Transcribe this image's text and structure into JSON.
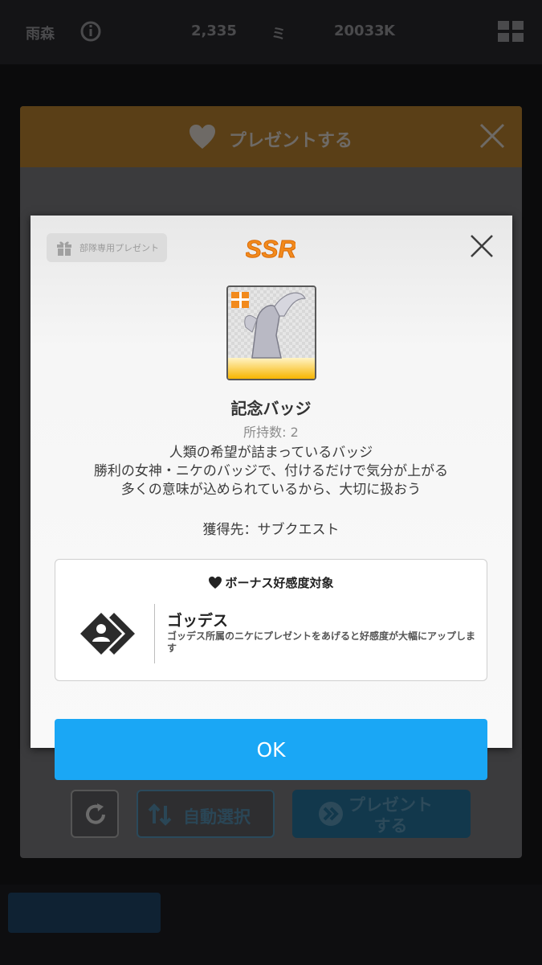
{
  "status_bar": {
    "items": [
      "雨森",
      "2,335",
      "20033",
      "K",
      "ミ"
    ]
  },
  "background_dialog": {
    "title": "プレゼントする",
    "auto_select_label": "自動選択",
    "present_label": "プレゼント\nする"
  },
  "modal": {
    "tag_label": "部隊専用プレゼント",
    "rarity": "SSR",
    "item_name": "記念バッジ",
    "owned_count": "所持数: 2",
    "description": "人類の希望が詰まっているバッジ\n勝利の女神・ニケのバッジで、付けるだけで気分が上がる\n多くの意味が込められているから、大切に扱おう",
    "source": "獲得先：サブクエスト",
    "bonus": {
      "title": "ボーナス好感度対象",
      "target_name": "ゴッデス",
      "target_desc": "ゴッデス所属のニケにプレゼントをあげると好感度が大幅にアップします"
    },
    "ok_label": "OK"
  },
  "colors": {
    "ok_button": "#1aa7f5",
    "rarity": "#f28a1c",
    "header_orange": "#5a3f17"
  }
}
